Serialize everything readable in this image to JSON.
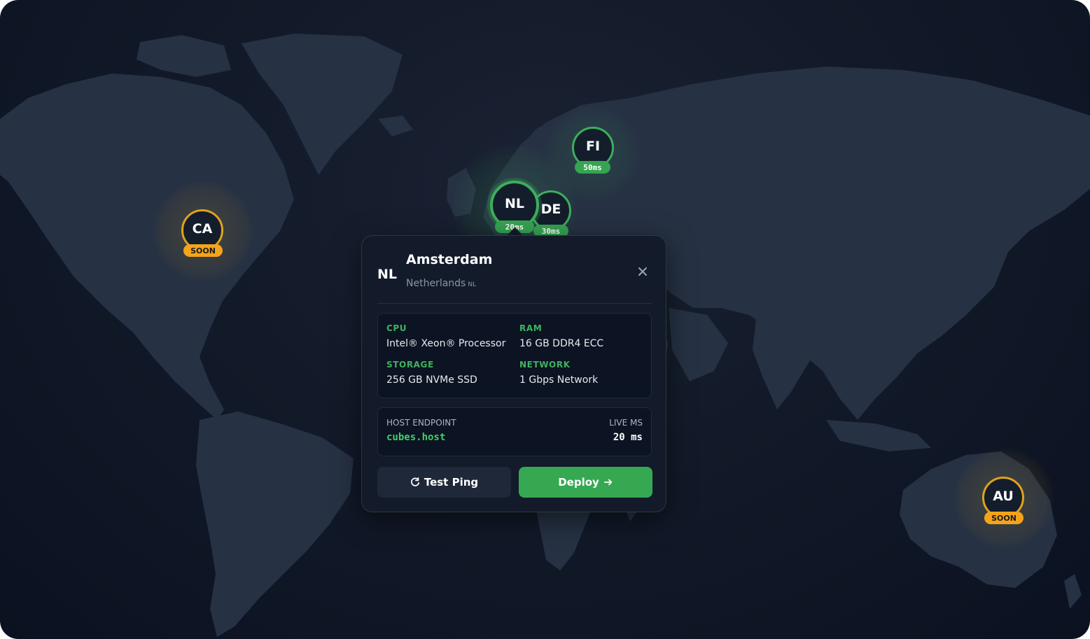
{
  "markers": [
    {
      "code": "NL",
      "badge": "20ms",
      "status": "active"
    },
    {
      "code": "DE",
      "badge": "30ms",
      "status": "active"
    },
    {
      "code": "FI",
      "badge": "50ms",
      "status": "active"
    },
    {
      "code": "CA",
      "badge": "SOON",
      "status": "soon"
    },
    {
      "code": "AU",
      "badge": "SOON",
      "status": "soon"
    }
  ],
  "popup": {
    "flag": "NL",
    "city": "Amsterdam",
    "country": "Netherlands",
    "country_code": "NL",
    "specs": {
      "cpu_label": "CPU",
      "cpu_value": "Intel® Xeon® Processor",
      "ram_label": "RAM",
      "ram_value": "16 GB DDR4 ECC",
      "storage_label": "STORAGE",
      "storage_value": "256 GB NVMe SSD",
      "network_label": "NETWORK",
      "network_value": "1 Gbps Network"
    },
    "endpoint": {
      "host_label": "HOST ENDPOINT",
      "host_value": "cubes.host",
      "ms_label": "LIVE MS",
      "ms_value": "20 ms"
    },
    "buttons": {
      "test_ping": "Test Ping",
      "deploy": "Deploy"
    }
  },
  "icons": {
    "close": "close-icon",
    "refresh": "refresh-icon",
    "arrow": "arrow-right-icon"
  },
  "colors": {
    "accent_green": "#36a852",
    "accent_gold": "#f5a31a",
    "background": "#121a29",
    "land": "#263143"
  }
}
